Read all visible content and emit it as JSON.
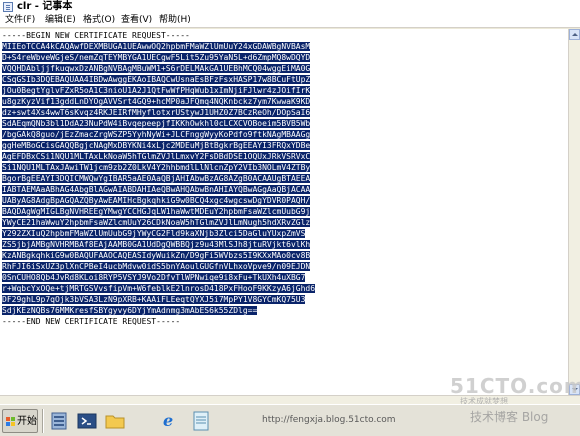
{
  "window": {
    "title": "clr - 记事本"
  },
  "menu": [
    {
      "label": "文件(F)"
    },
    {
      "label": "编辑(E)"
    },
    {
      "label": "格式(O)"
    },
    {
      "label": "查看(V)"
    },
    {
      "label": "帮助(H)"
    }
  ],
  "document": {
    "lines": [
      {
        "text": "-----BEGIN NEW CERTIFICATE REQUEST-----",
        "selected": false
      },
      {
        "text": "MIIEoTCCA4kCAQAwfDEXMBUGA1UEAwwOQ2hpbmFMaWZlUmUuY24xGDAWBgNVBAsM",
        "selected": true
      },
      {
        "text": "D+S4reWbveWGjeS/nemZqTEYMBYGA1UECgwF5Lit5Zu95YaN5L+d6ZmpMQ8wDQYD",
        "selected": true
      },
      {
        "text": "VQQHDAbljjfkuqwxDzANBgNVBAgMBuWM1+S6rDELMAkGA1UEBhMCQ04wggEiMA0G",
        "selected": true
      },
      {
        "text": "CSqGSIb3DQEBAQUAA4IBDwAwggEKAoIBAQCwUsnaEsBFzFsxHASP17w8BCuFtUpZ",
        "selected": true
      },
      {
        "text": "jOu0BegtYglvFZxR5oA1C3nioU1A2J1QtFwWfPHqWub1xImNjiFJlwr4zJOifIrK",
        "selected": true
      },
      {
        "text": "u8gzKyzVif13gddLnDYOgAVVSrt4GQ9+hcMP0aJFQmq4NQKnbckz7ym7KwwaK9KD",
        "selected": true
      },
      {
        "text": "dz+swt4Xs4wwT6sKvqz4RKJEIRfMHyflotxrUStywJ1UHZ0Z7BCzReOh/DOpSaI6",
        "selected": true
      },
      {
        "text": "SdAEqmQNb3bl1DdA23NuPdW4iBvqepeepjfIKKhOwkhl0cLCXCVOBoeim5BVB5Wb",
        "selected": true
      },
      {
        "text": "/bgGAkQ8guo/jEzZmacZrgWSZP5YyhNyWi+JLCFnggWyyKoPdfo9ftkNAgMBAAGg",
        "selected": true
      },
      {
        "text": "ggHeMBoGCisGAQQBgjcNAgMxDBYKNi4xLjc2MDEuMjBtBgkrBgEEAYI3FRQxYDBe",
        "selected": true
      },
      {
        "text": "AgEFDBxCSi1NQU1MLTAxLkNoaW5hTGlmZVJlLmxvY2FsDBdDSE1OQUxJRkVSRVxC",
        "selected": true
      },
      {
        "text": "Si1NQU1MLTAxJAwiTW1jcm9zb2Z0LkV4Y2hhbmdlLlNlcnZpY2VIb3NOLmV4ZTBy",
        "selected": true
      },
      {
        "text": "BgorBgEEAYI3DQICMWQwYgIBAR5aAE0AaQBjAHIAbwBzAG8AZgB0ACAAUgBTAEEA",
        "selected": true
      },
      {
        "text": "IABTAEMAaABhAG4AbgBlAGwAIABDAHIAeQBwAHQAbwBnAHIAYQBwAGgAaQBjACAA",
        "selected": true
      },
      {
        "text": "UAByAG8AdgBpAGQAZQByAwEAMIHcBgkqhkiG9w0BCQ4xgc4wgcswDgYDVR0PAQH/",
        "selected": true
      },
      {
        "text": "BAQDAgWgMIGLBgNVHREEgYMwgYCCHGJqLW1haWwtMDEuY2hpbmFsaWZlcmUubG9j",
        "selected": true
      },
      {
        "text": "YWyCE21haWwuY2hpbmFsaWZlcmUuY26CDkNoaW5hTGlmZVJlLmNugh5hdXRvZGlz",
        "selected": true
      },
      {
        "text": "Y292ZXIuQ2hpbmFMaWZlUmUubG9jYWyCG2Fld9kaXNjb3Zlci5DaGluYUxpZmVS",
        "selected": true
      },
      {
        "text": "ZS5jbjAMBgNVHRMBAf8EAjAAMB0GA1UdDgQWBBQjz9u43MlSJh8jtuRVjkt6vlKh",
        "selected": true
      },
      {
        "text": "KzANBgkqhkiG9w0BAQUFAAOCAQEASIdyWuikZn/D9gFi5WVbzs5I9KXxMAo0cv8B",
        "selected": true
      },
      {
        "text": "RhFJI6iSxUZ3plXnCPBeI4ucbMdvw0idS5bnYAoulGUGfnVLhxoVpve9/n09EJDN",
        "selected": true
      },
      {
        "text": "0SnCUHO8Qb4JvRd8KLoi8RYP5VSYJ9Vo2DfvTlWPNwiqe9i8xFu+TkUXh4uXBG7",
        "selected": true
      },
      {
        "text": "r+WqbcYxOQe+tjMRTGSVvsfipVm+W6feblkE2lnrosD418PxFHooF9KKzyA6jGhd6",
        "selected": true
      },
      {
        "text": "DF29ghL9p7qOjk3bVSA3LzN9pXRB+KAAiFLEeqtQYXJ5i7MpPY1V8GYCmKQ75U3",
        "selected": true
      },
      {
        "text": "SdjKEzNQBs76MMKresfSBYgyvy6DYjYmAdnmg3mAbES6k55ZDlg==",
        "selected": true
      },
      {
        "text": "-----END NEW CERTIFICATE REQUEST-----",
        "selected": false
      }
    ]
  },
  "taskbar": {
    "start_label": "开始",
    "url_text": "http://fengxja.blog.51cto.com"
  },
  "watermark": {
    "main": "51CTO.com",
    "sub": "技术成就梦想",
    "blog": "技术博客 Blog"
  }
}
